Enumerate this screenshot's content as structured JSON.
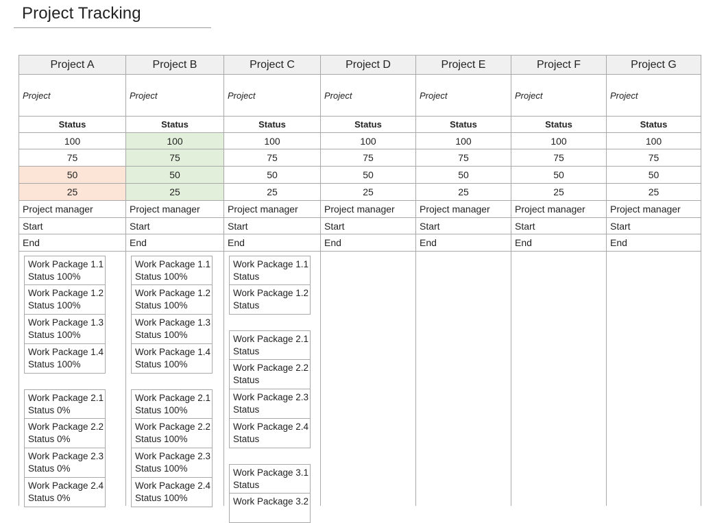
{
  "page": {
    "title": "Project Tracking"
  },
  "colors": {
    "status_green": "#e2efda",
    "status_orange": "#fce4d6",
    "header_bg": "#f0f0f0",
    "grid": "#a8a8a8"
  },
  "labels": {
    "project": "Project",
    "status": "Status",
    "levels": [
      "100",
      "75",
      "50",
      "25"
    ],
    "project_manager": "Project manager",
    "start": "Start",
    "end": "End"
  },
  "projects": [
    {
      "name": "Project A",
      "highlight": {
        "100": "",
        "75": "",
        "50": "orange",
        "25": "orange"
      },
      "groups": [
        [
          {
            "name": "Work Package 1.1",
            "status": "Status 100%"
          },
          {
            "name": "Work Package 1.2",
            "status": "Status 100%"
          },
          {
            "name": "Work Package 1.3",
            "status": "Status 100%"
          },
          {
            "name": "Work Package 1.4",
            "status": "Status 100%"
          }
        ],
        [
          {
            "name": "Work Package 2.1",
            "status": "Status 0%"
          },
          {
            "name": "Work Package 2.2",
            "status": "Status 0%"
          },
          {
            "name": "Work Package 2.3",
            "status": "Status 0%"
          },
          {
            "name": "Work Package 2.4",
            "status": "Status 0%"
          }
        ]
      ]
    },
    {
      "name": "Project B",
      "highlight": {
        "100": "green",
        "75": "green",
        "50": "green",
        "25": "green"
      },
      "groups": [
        [
          {
            "name": "Work Package 1.1",
            "status": "Status 100%"
          },
          {
            "name": "Work Package 1.2",
            "status": "Status 100%"
          },
          {
            "name": "Work Package 1.3",
            "status": "Status 100%"
          },
          {
            "name": "Work Package 1.4",
            "status": "Status 100%"
          }
        ],
        [
          {
            "name": "Work Package 2.1",
            "status": "Status 100%"
          },
          {
            "name": "Work Package 2.2",
            "status": "Status 100%"
          },
          {
            "name": "Work Package 2.3",
            "status": "Status 100%"
          },
          {
            "name": "Work Package 2.4",
            "status": "Status 100%"
          }
        ]
      ]
    },
    {
      "name": "Project C",
      "highlight": {
        "100": "",
        "75": "",
        "50": "",
        "25": ""
      },
      "groups": [
        [
          {
            "name": "Work Package 1.1",
            "status": "Status"
          },
          {
            "name": "Work Package 1.2",
            "status": "Status"
          }
        ],
        [
          {
            "name": "Work Package 2.1",
            "status": "Status"
          },
          {
            "name": "Work Package 2.2",
            "status": "Status"
          },
          {
            "name": "Work Package 2.3",
            "status": "Status"
          },
          {
            "name": "Work Package 2.4",
            "status": "Status"
          }
        ],
        [
          {
            "name": "Work Package 3.1",
            "status": "Status"
          },
          {
            "name": "Work Package 3.2",
            "status": ""
          }
        ]
      ]
    },
    {
      "name": "Project D",
      "highlight": {
        "100": "",
        "75": "",
        "50": "",
        "25": ""
      },
      "groups": []
    },
    {
      "name": "Project E",
      "highlight": {
        "100": "",
        "75": "",
        "50": "",
        "25": ""
      },
      "groups": []
    },
    {
      "name": "Project F",
      "highlight": {
        "100": "",
        "75": "",
        "50": "",
        "25": ""
      },
      "groups": []
    },
    {
      "name": "Project G",
      "highlight": {
        "100": "",
        "75": "",
        "50": "",
        "25": ""
      },
      "groups": []
    }
  ]
}
